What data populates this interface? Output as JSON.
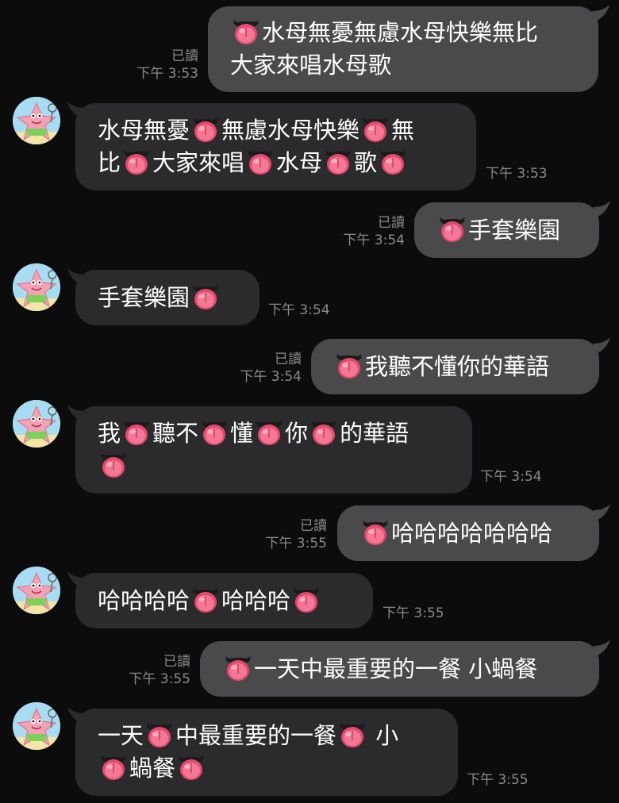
{
  "chat": {
    "read_label": "已讀",
    "colors": {
      "background": "#0c0c0d",
      "mine_bubble": "#4a4a4c",
      "their_bubble": "#2b2b2d",
      "meta_text": "#8a8a8e"
    },
    "avatar_icon": "patrick-star-avatar",
    "emoji_icon": "tongue-out-emoji",
    "messages": [
      {
        "sender": "me",
        "lines": [
          "[e]水母無憂無慮水母快樂無比",
          "大家來唱水母歌"
        ],
        "time": "下午 3:53",
        "read": true
      },
      {
        "sender": "them",
        "lines": [
          "水母無憂[e]無慮水母快樂[e]無",
          "比[e]大家來唱[e]水母[e]歌[e]"
        ],
        "time": "下午 3:53"
      },
      {
        "sender": "me",
        "lines": [
          "[e]手套樂園"
        ],
        "time": "下午 3:54",
        "read": true
      },
      {
        "sender": "them",
        "lines": [
          "手套樂園[e]"
        ],
        "time": "下午 3:54"
      },
      {
        "sender": "me",
        "lines": [
          "[e]我聽不懂你的華語"
        ],
        "time": "下午 3:54",
        "read": true
      },
      {
        "sender": "them",
        "lines": [
          "我[e]聽不[e]懂[e]你[e]的華語",
          "[e]"
        ],
        "time": "下午 3:54"
      },
      {
        "sender": "me",
        "lines": [
          "[e]哈哈哈哈哈哈哈"
        ],
        "time": "下午 3:55",
        "read": true
      },
      {
        "sender": "them",
        "lines": [
          "哈哈哈哈[e]哈哈哈[e]"
        ],
        "time": "下午 3:55"
      },
      {
        "sender": "me",
        "lines": [
          "[e]一天中最重要的一餐 小蝸餐"
        ],
        "time": "下午 3:55",
        "read": true
      },
      {
        "sender": "them",
        "lines": [
          "一天[e]中最重要的一餐[e] 小",
          "[e]蝸餐[e]"
        ],
        "time": "下午 3:55"
      }
    ]
  }
}
